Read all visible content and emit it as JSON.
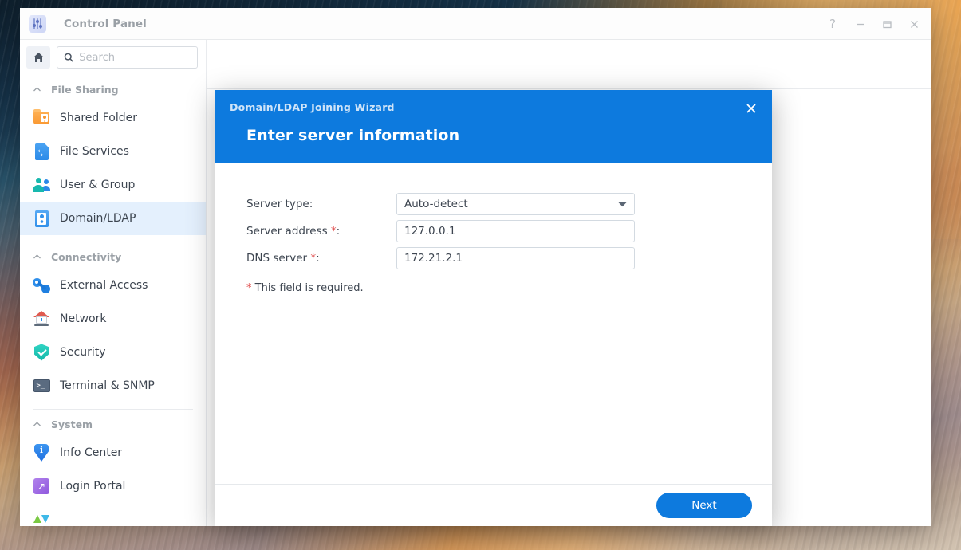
{
  "window": {
    "title": "Control Panel",
    "app_icon": "control-panel-icon",
    "controls": [
      {
        "name": "help-button",
        "glyph": "?"
      },
      {
        "name": "minimize-button",
        "glyph": "–"
      },
      {
        "name": "maximize-button",
        "glyph": "□"
      },
      {
        "name": "close-button",
        "glyph": "✕"
      }
    ]
  },
  "sidebar": {
    "home_icon": "home-icon",
    "search": {
      "placeholder": "Search",
      "value": "",
      "icon": "search-icon"
    },
    "groups": [
      {
        "label": "File Sharing",
        "collapse_icon": "chevron-up-icon",
        "items": [
          {
            "label": "Shared Folder",
            "icon": "shared-folder-icon",
            "active": false
          },
          {
            "label": "File Services",
            "icon": "file-services-icon",
            "active": false
          },
          {
            "label": "User & Group",
            "icon": "user-group-icon",
            "active": false
          },
          {
            "label": "Domain/LDAP",
            "icon": "domain-ldap-icon",
            "active": true
          }
        ]
      },
      {
        "label": "Connectivity",
        "collapse_icon": "chevron-up-icon",
        "items": [
          {
            "label": "External Access",
            "icon": "external-access-icon",
            "active": false
          },
          {
            "label": "Network",
            "icon": "network-icon",
            "active": false
          },
          {
            "label": "Security",
            "icon": "security-shield-icon",
            "active": false
          },
          {
            "label": "Terminal & SNMP",
            "icon": "terminal-icon",
            "active": false
          }
        ]
      },
      {
        "label": "System",
        "collapse_icon": "chevron-up-icon",
        "items": [
          {
            "label": "Info Center",
            "icon": "info-center-icon",
            "active": false
          },
          {
            "label": "Login Portal",
            "icon": "login-portal-icon",
            "active": false
          },
          {
            "label": "",
            "icon": "update-restore-icon",
            "active": false
          }
        ]
      }
    ]
  },
  "dialog": {
    "subtitle": "Domain/LDAP Joining Wizard",
    "title": "Enter server information",
    "close_icon": "close-icon",
    "fields": [
      {
        "name": "server-type",
        "label": "Server type:",
        "required": false,
        "type": "select",
        "value": "Auto-detect",
        "caret_icon": "chevron-down-icon"
      },
      {
        "name": "server-address",
        "label": "Server address ",
        "required": true,
        "type": "text",
        "value": "127.0.0.1",
        "placeholder": ""
      },
      {
        "name": "dns-server",
        "label": "DNS server ",
        "required": true,
        "type": "text",
        "value": "172.21.2.1",
        "placeholder": ""
      }
    ],
    "required_marker": "*",
    "label_colon": ":",
    "required_note": "This field is required.",
    "next_label": "Next"
  },
  "colors": {
    "accent": "#0d7ade",
    "active_nav_bg": "#e4f0fd",
    "required_red": "#e04a4a",
    "title_grey": "#9aa0a6"
  }
}
